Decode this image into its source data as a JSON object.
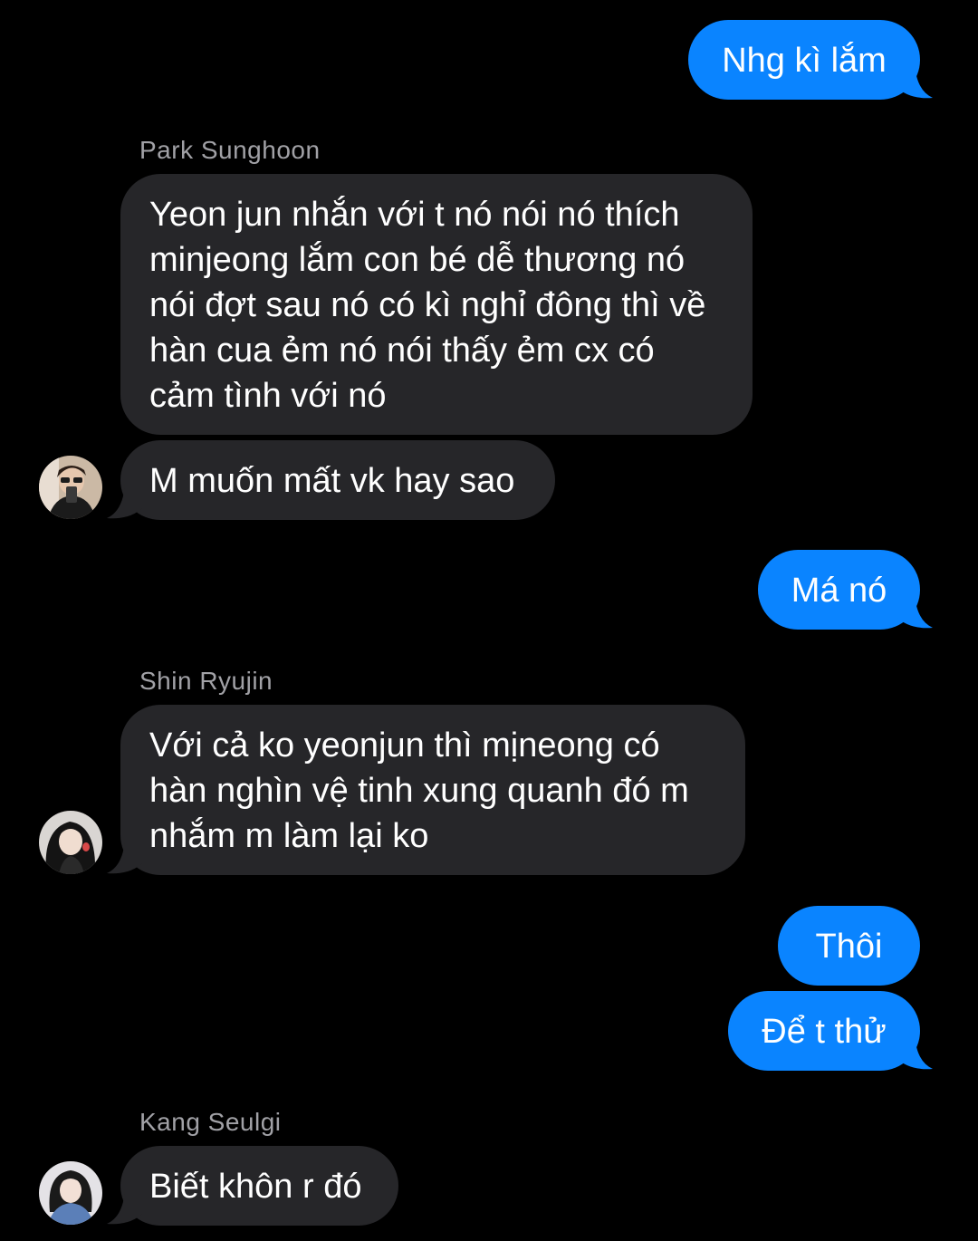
{
  "colors": {
    "outgoing_bubble": "#0a84ff",
    "incoming_bubble": "#262629",
    "background": "#000000",
    "sender_name": "#a1a1a6"
  },
  "messages": [
    {
      "from": "me",
      "text": "Nhg kì lắm"
    },
    {
      "from": "Park Sunghoon",
      "sender_label": "Park Sunghoon",
      "text": "Yeon jun nhắn với t nó nói nó thích minjeong lắm con bé dễ thương nó nói đợt sau nó có kì nghỉ đông thì về hàn cua ẻm nó nói thấy ẻm cx có cảm tình với nó"
    },
    {
      "from": "Park Sunghoon",
      "text": "M muốn mất vk hay sao",
      "avatar_icon": "avatar-park-sunghoon"
    },
    {
      "from": "me",
      "text": "Má nó"
    },
    {
      "from": "Shin Ryujin",
      "sender_label": "Shin Ryujin",
      "text": "Với cả ko yeonjun thì mịneong có hàn nghìn vệ tinh xung quanh đó m nhắm m làm lại ko",
      "avatar_icon": "avatar-shin-ryujin"
    },
    {
      "from": "me",
      "text": "Thôi"
    },
    {
      "from": "me",
      "text": "Để t thử"
    },
    {
      "from": "Kang Seulgi",
      "sender_label": "Kang Seulgi",
      "text": "Biết khôn r đó",
      "avatar_icon": "avatar-kang-seulgi"
    }
  ]
}
